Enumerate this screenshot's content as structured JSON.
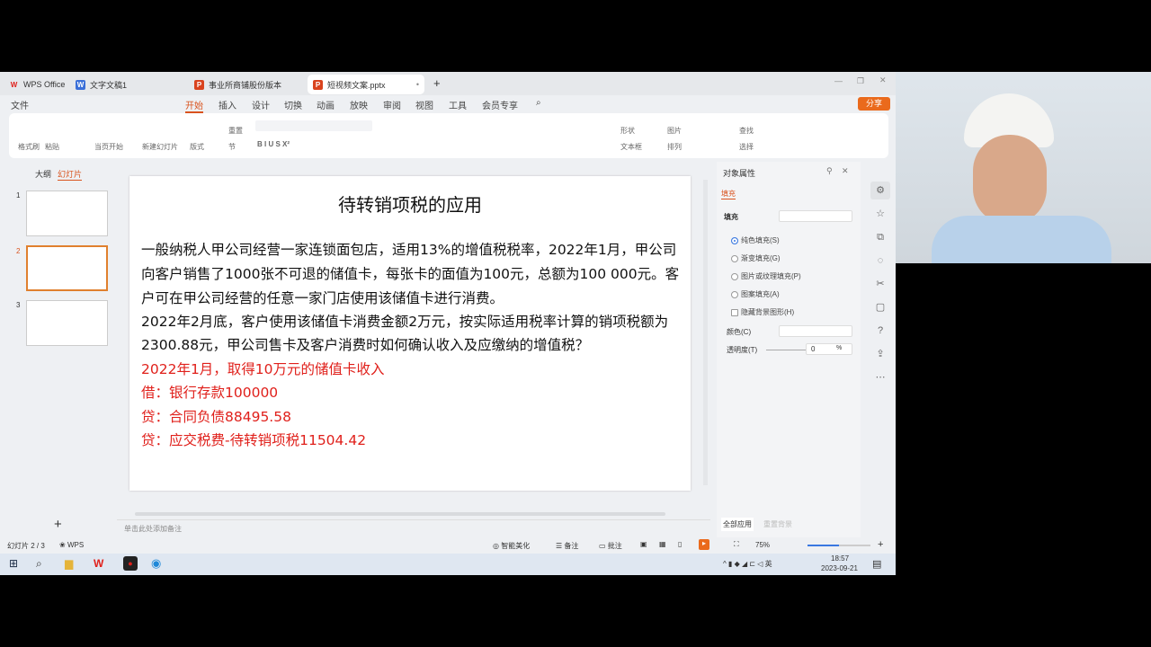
{
  "tabs": [
    {
      "label": "WPS Office",
      "icon": "wps-logo"
    },
    {
      "label": "文字文稿1",
      "icon": "W"
    },
    {
      "label": "事业所商铺股份版本",
      "icon": "P"
    },
    {
      "label": "短视频文案.pptx",
      "icon": "P"
    }
  ],
  "menu": {
    "file": "文件",
    "items": [
      "开始",
      "插入",
      "设计",
      "切换",
      "动画",
      "放映",
      "审阅",
      "视图",
      "工具",
      "会员专享"
    ],
    "active": "开始",
    "share": "分享"
  },
  "ribbon": {
    "format_painter": "格式刷",
    "paste": "粘贴",
    "from_current": "当页开始",
    "new_slide": "新建幻灯片",
    "layout": "版式",
    "section": "节",
    "reset": "重置",
    "shape": "形状",
    "picture": "图片",
    "textbox": "文本框",
    "arrange": "排列",
    "find": "查找",
    "select": "选择"
  },
  "left_panel": {
    "tabs": [
      "大纲",
      "幻灯片"
    ],
    "active": "幻灯片",
    "thumbs": [
      "1",
      "2",
      "3"
    ],
    "add": "+"
  },
  "slide": {
    "title": "待转销项税的应用",
    "lines": [
      "一般纳税人甲公司经营一家连锁面包店，适用13%的增值税税率，2022年1月，甲公司",
      "向客户销售了1000张不可退的储值卡，每张卡的面值为100元，总额为100 000元。客",
      "户可在甲公司经营的任意一家门店使用该储值卡进行消费。",
      "2022年2月底，客户使用该储值卡消费金额2万元，按实际适用税率计算的销项税额为",
      "2300.88元，甲公司售卡及客户消费时如何确认收入及应缴纳的增值税？"
    ],
    "red_lines": [
      "2022年1月，取得10万元的储值卡收入",
      "借：银行存款100000",
      "贷：合同负债88495.58",
      "贷：应交税费-待转销项税11504.42"
    ]
  },
  "notes_placeholder": "单击此处添加备注",
  "props": {
    "title": "对象属性",
    "tab": "填充",
    "fill_label": "填充",
    "options": [
      "纯色填充(S)",
      "渐变填充(G)",
      "图片或纹理填充(P)",
      "图案填充(A)"
    ],
    "hide_bg": "隐藏背景图形(H)",
    "color_label": "颜色(C)",
    "transparency_label": "透明度(T)",
    "transparency_value": "0",
    "percent": "%",
    "apply_all": "全部应用",
    "reset_bg": "重置背景"
  },
  "status": {
    "slide_info": "幻灯片 2 / 3",
    "theme": "WPS",
    "beautify": "智能美化",
    "notes": "备注",
    "comment": "批注",
    "zoom": "75%",
    "zoom_fraction": 0.5
  },
  "taskbar": {
    "time": "18:57",
    "date": "2023-09-21",
    "ime": "英"
  }
}
